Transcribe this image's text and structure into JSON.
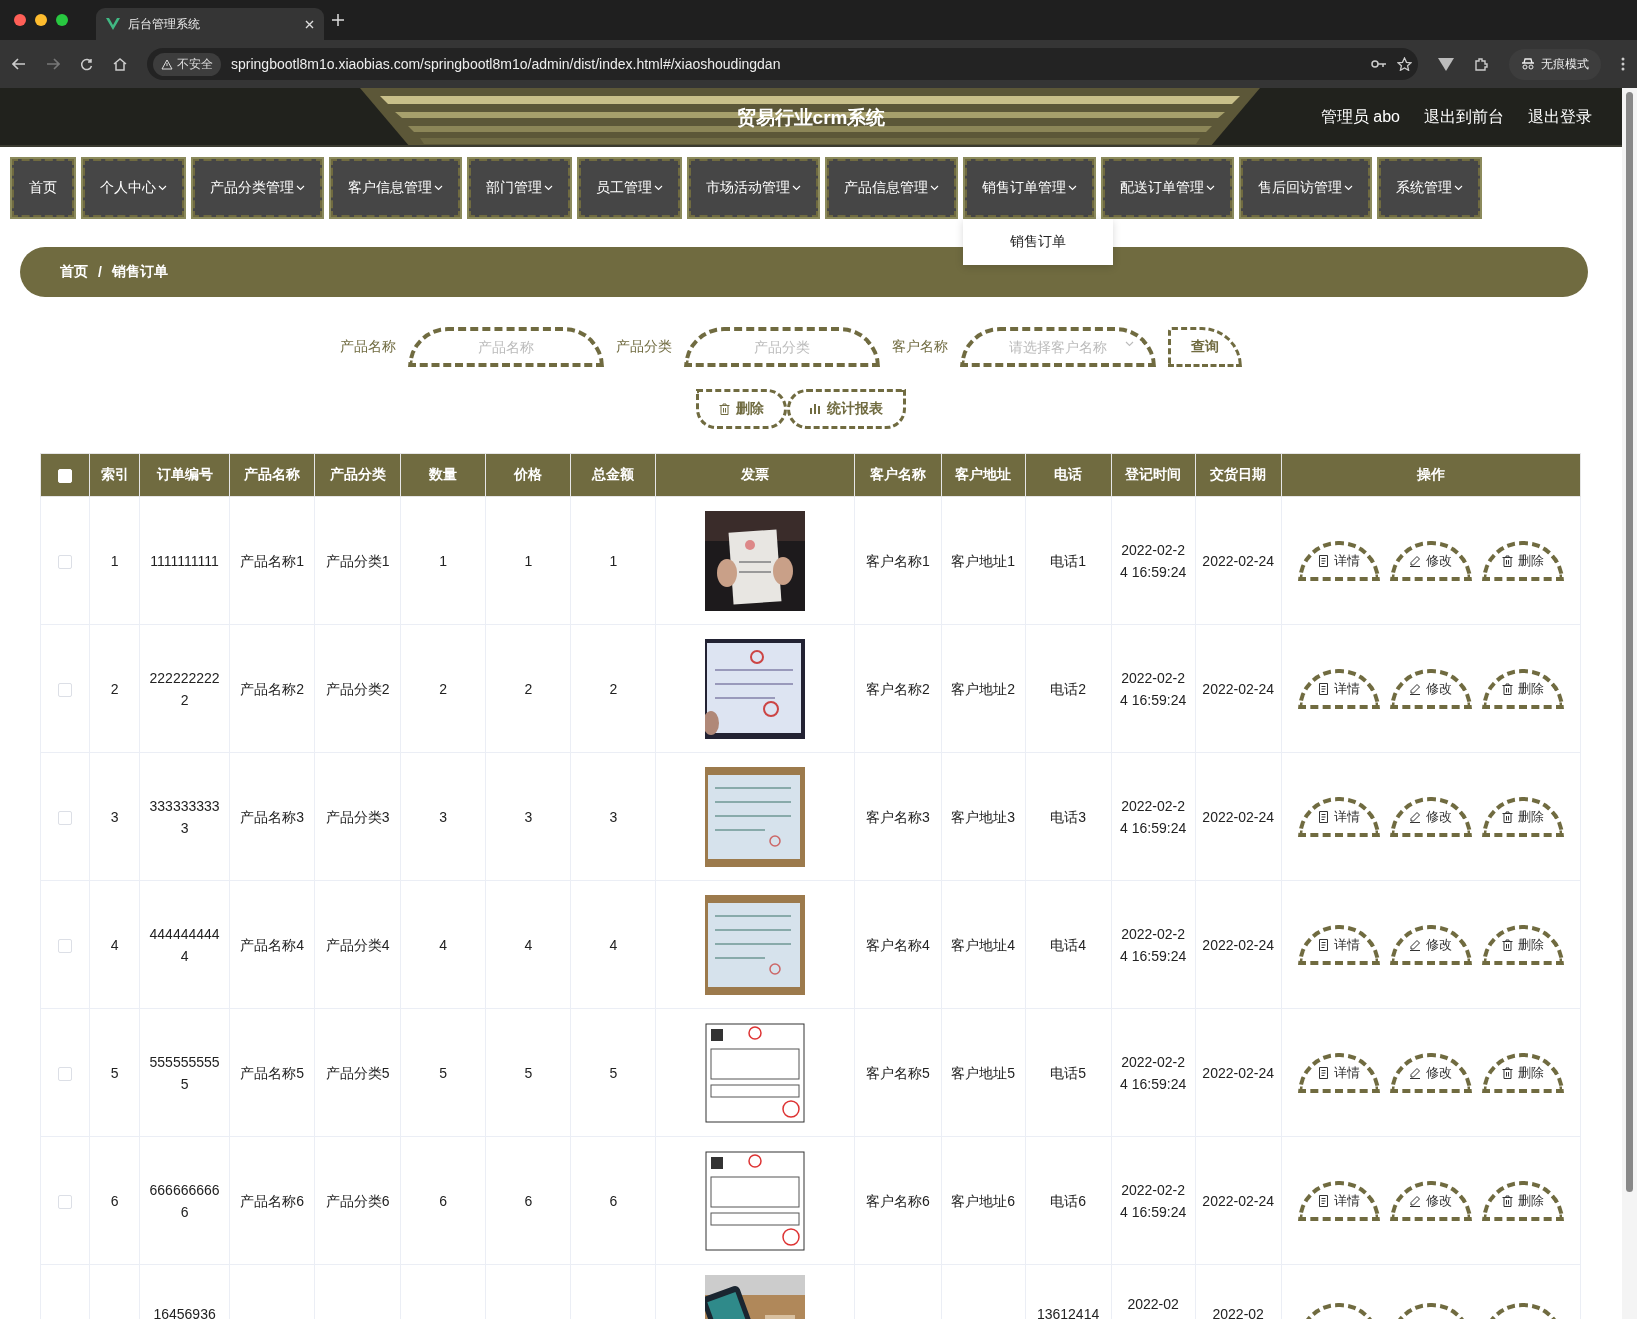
{
  "browser": {
    "tab_title": "后台管理系统",
    "security": "不安全",
    "url": "springbootl8m1o.xiaobias.com/springbootl8m1o/admin/dist/index.html#/xiaoshoudingdan",
    "profile": "无痕模式"
  },
  "header": {
    "title": "贸易行业crm系统",
    "links": [
      "管理员 abo",
      "退出到前台",
      "退出登录"
    ]
  },
  "nav": [
    {
      "label": "首页",
      "dropdown": false
    },
    {
      "label": "个人中心",
      "dropdown": true
    },
    {
      "label": "产品分类管理",
      "dropdown": true
    },
    {
      "label": "客户信息管理",
      "dropdown": true
    },
    {
      "label": "部门管理",
      "dropdown": true
    },
    {
      "label": "员工管理",
      "dropdown": true
    },
    {
      "label": "市场活动管理",
      "dropdown": true
    },
    {
      "label": "产品信息管理",
      "dropdown": true
    },
    {
      "label": "销售订单管理",
      "dropdown": true,
      "menu": [
        "销售订单"
      ]
    },
    {
      "label": "配送订单管理",
      "dropdown": true
    },
    {
      "label": "售后回访管理",
      "dropdown": true
    },
    {
      "label": "系统管理",
      "dropdown": true
    }
  ],
  "breadcrumb": {
    "items": [
      "首页",
      "销售订单"
    ],
    "separator": "/"
  },
  "search": {
    "fields": [
      {
        "label": "产品名称",
        "placeholder": "产品名称",
        "kind": "input"
      },
      {
        "label": "产品分类",
        "placeholder": "产品分类",
        "kind": "input"
      },
      {
        "label": "客户名称",
        "placeholder": "请选择客户名称",
        "kind": "select"
      }
    ],
    "query_button": "查询",
    "delete_button": "删除",
    "report_button": "统计报表"
  },
  "table": {
    "columns": [
      "索引",
      "订单编号",
      "产品名称",
      "产品分类",
      "数量",
      "价格",
      "总金额",
      "发票",
      "客户名称",
      "客户地址",
      "电话",
      "登记时间",
      "交货日期",
      "操作"
    ],
    "all_checked": false,
    "rows": [
      {
        "checked": false,
        "index": "1",
        "order_no": "1111111111",
        "product": "产品名称1",
        "category": "产品分类1",
        "qty": "1",
        "price": "1",
        "total": "1",
        "customer": "客户名称1",
        "address": "客户地址1",
        "phone": "电话1",
        "registered": "2022-02-24 16:59:24",
        "delivery": "2022-02-24",
        "actions": [
          {
            "kind": "detail",
            "label": "详情"
          },
          {
            "kind": "edit",
            "label": "修改"
          },
          {
            "kind": "delete",
            "label": "删除"
          }
        ]
      },
      {
        "checked": false,
        "index": "2",
        "order_no": "2222222222",
        "product": "产品名称2",
        "category": "产品分类2",
        "qty": "2",
        "price": "2",
        "total": "2",
        "customer": "客户名称2",
        "address": "客户地址2",
        "phone": "电话2",
        "registered": "2022-02-24 16:59:24",
        "delivery": "2022-02-24",
        "actions": [
          {
            "kind": "detail",
            "label": "详情"
          },
          {
            "kind": "edit",
            "label": "修改"
          },
          {
            "kind": "delete",
            "label": "删除"
          }
        ]
      },
      {
        "checked": false,
        "index": "3",
        "order_no": "3333333333",
        "product": "产品名称3",
        "category": "产品分类3",
        "qty": "3",
        "price": "3",
        "total": "3",
        "customer": "客户名称3",
        "address": "客户地址3",
        "phone": "电话3",
        "registered": "2022-02-24 16:59:24",
        "delivery": "2022-02-24",
        "actions": [
          {
            "kind": "detail",
            "label": "详情"
          },
          {
            "kind": "edit",
            "label": "修改"
          },
          {
            "kind": "delete",
            "label": "删除"
          }
        ]
      },
      {
        "checked": false,
        "index": "4",
        "order_no": "4444444444",
        "product": "产品名称4",
        "category": "产品分类4",
        "qty": "4",
        "price": "4",
        "total": "4",
        "customer": "客户名称4",
        "address": "客户地址4",
        "phone": "电话4",
        "registered": "2022-02-24 16:59:24",
        "delivery": "2022-02-24",
        "actions": [
          {
            "kind": "detail",
            "label": "详情"
          },
          {
            "kind": "edit",
            "label": "修改"
          },
          {
            "kind": "delete",
            "label": "删除"
          }
        ]
      },
      {
        "checked": false,
        "index": "5",
        "order_no": "5555555555",
        "product": "产品名称5",
        "category": "产品分类5",
        "qty": "5",
        "price": "5",
        "total": "5",
        "customer": "客户名称5",
        "address": "客户地址5",
        "phone": "电话5",
        "registered": "2022-02-24 16:59:24",
        "delivery": "2022-02-24",
        "actions": [
          {
            "kind": "detail",
            "label": "详情"
          },
          {
            "kind": "edit",
            "label": "修改"
          },
          {
            "kind": "delete",
            "label": "删除"
          }
        ]
      },
      {
        "checked": false,
        "index": "6",
        "order_no": "6666666666",
        "product": "产品名称6",
        "category": "产品分类6",
        "qty": "6",
        "price": "6",
        "total": "6",
        "customer": "客户名称6",
        "address": "客户地址6",
        "phone": "电话6",
        "registered": "2022-02-24 16:59:24",
        "delivery": "2022-02-24",
        "actions": [
          {
            "kind": "detail",
            "label": "详情"
          },
          {
            "kind": "edit",
            "label": "修改"
          },
          {
            "kind": "delete",
            "label": "删除"
          }
        ]
      },
      {
        "order_no": "16456936",
        "phone": "13612414",
        "registered": "2022-02",
        "delivery": "2022-02",
        "actions": [
          {
            "kind": "detail"
          },
          {
            "kind": "edit"
          },
          {
            "kind": "delete"
          }
        ]
      }
    ]
  }
}
